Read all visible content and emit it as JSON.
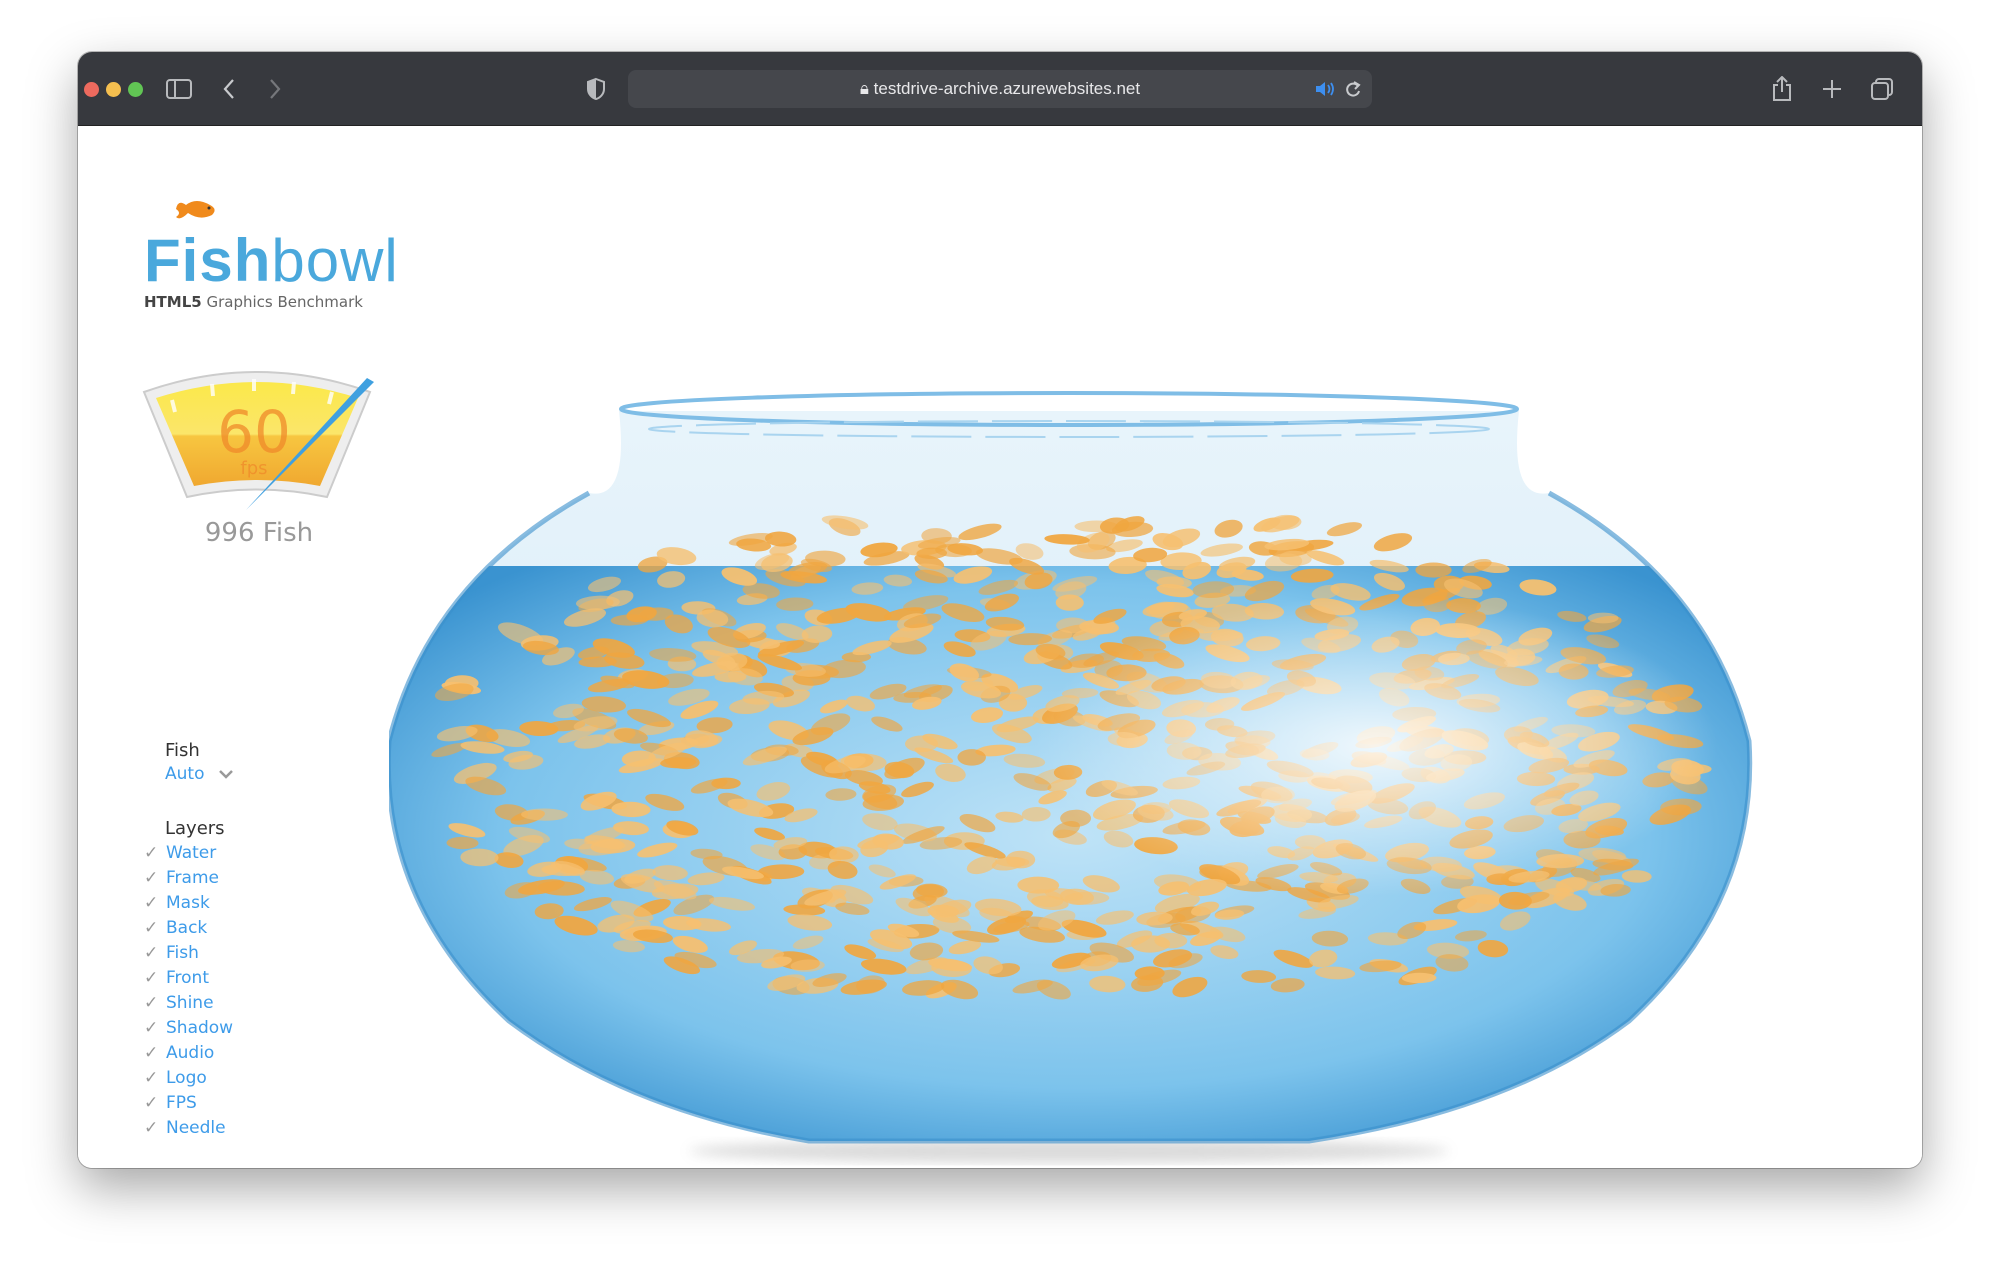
{
  "browser": {
    "url": "testdrive-archive.azurewebsites.net",
    "traffic_lights": {
      "close": "#ed6a5e",
      "minimize": "#f5bf4f",
      "zoom": "#61c554"
    },
    "icons": [
      "sidebar-icon",
      "back-icon",
      "forward-icon",
      "shield-icon",
      "lock-icon",
      "speaker-icon",
      "reload-icon",
      "share-icon",
      "new-tab-icon",
      "tab-overview-icon"
    ]
  },
  "logo": {
    "title_bold": "Fish",
    "title_light": "bowl",
    "subtitle_bold": "HTML5",
    "subtitle": "Graphics Benchmark"
  },
  "gauge": {
    "fps_value": "60",
    "fps_unit": "fps"
  },
  "fish_count": "996 Fish",
  "controls": {
    "fish_label": "Fish",
    "fish_mode": "Auto",
    "layers_label": "Layers",
    "layers": [
      {
        "label": "Water",
        "checked": true
      },
      {
        "label": "Frame",
        "checked": true
      },
      {
        "label": "Mask",
        "checked": true
      },
      {
        "label": "Back",
        "checked": true
      },
      {
        "label": "Fish",
        "checked": true
      },
      {
        "label": "Front",
        "checked": true
      },
      {
        "label": "Shine",
        "checked": true
      },
      {
        "label": "Shadow",
        "checked": true
      },
      {
        "label": "Audio",
        "checked": true
      },
      {
        "label": "Logo",
        "checked": true
      },
      {
        "label": "FPS",
        "checked": true
      },
      {
        "label": "Needle",
        "checked": true
      }
    ]
  },
  "colors": {
    "accent": "#3d9be9",
    "logo_blue": "#4aa8dc",
    "water": "#5fb3e6",
    "fish": "#f0a640"
  }
}
